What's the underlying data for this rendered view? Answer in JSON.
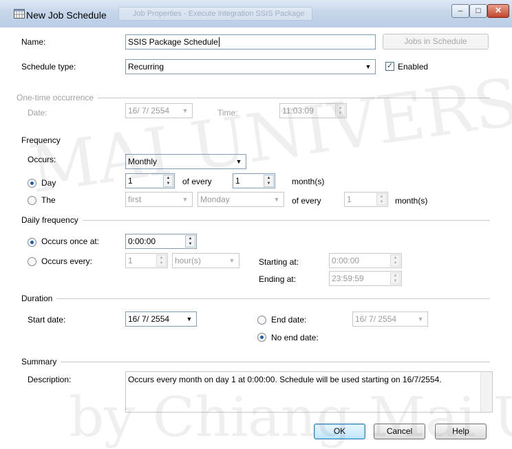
{
  "window": {
    "title": "New Job Schedule",
    "ghost_tab": "Job Properties - Execute Integration SSIS Package",
    "min": "–",
    "max": "□",
    "close": "✕"
  },
  "name": {
    "label": "Name:",
    "value": "SSIS Package Schedule",
    "jobs_button": "Jobs in Schedule"
  },
  "schedule_type": {
    "label": "Schedule type:",
    "value": "Recurring",
    "enabled_label": "Enabled",
    "enabled": true
  },
  "one_time": {
    "group": "One-time occurrence",
    "date_label": "Date:",
    "date": "16/ 7/ 2554",
    "time_label": "Time:",
    "time": "11:03:09"
  },
  "frequency": {
    "group": "Frequency",
    "occurs_label": "Occurs:",
    "occurs": "Monthly",
    "day_label": "Day",
    "day_value": "1",
    "of_every": "of every",
    "every_value": "1",
    "months": "month(s)",
    "the_label": "The",
    "the_ordinal": "first",
    "the_weekday": "Monday",
    "the_every_value": "1"
  },
  "daily": {
    "group": "Daily frequency",
    "once_label": "Occurs once at:",
    "once_time": "0:00:00",
    "every_label": "Occurs every:",
    "every_value": "1",
    "every_unit": "hour(s)",
    "starting_label": "Starting at:",
    "starting": "0:00:00",
    "ending_label": "Ending at:",
    "ending": "23:59:59"
  },
  "duration": {
    "group": "Duration",
    "start_label": "Start date:",
    "start": "16/ 7/ 2554",
    "end_label": "End date:",
    "end": "16/ 7/ 2554",
    "no_end_label": "No end date:"
  },
  "summary": {
    "group": "Summary",
    "desc_label": "Description:",
    "description": "Occurs every month on day 1 at 0:00:00. Schedule will be used starting on 16/7/2554."
  },
  "buttons": {
    "ok": "OK",
    "cancel": "Cancel",
    "help": "Help"
  },
  "watermark": {
    "line1": "MAI UNIVERSITY",
    "line2": "by Chiang Mai U"
  }
}
